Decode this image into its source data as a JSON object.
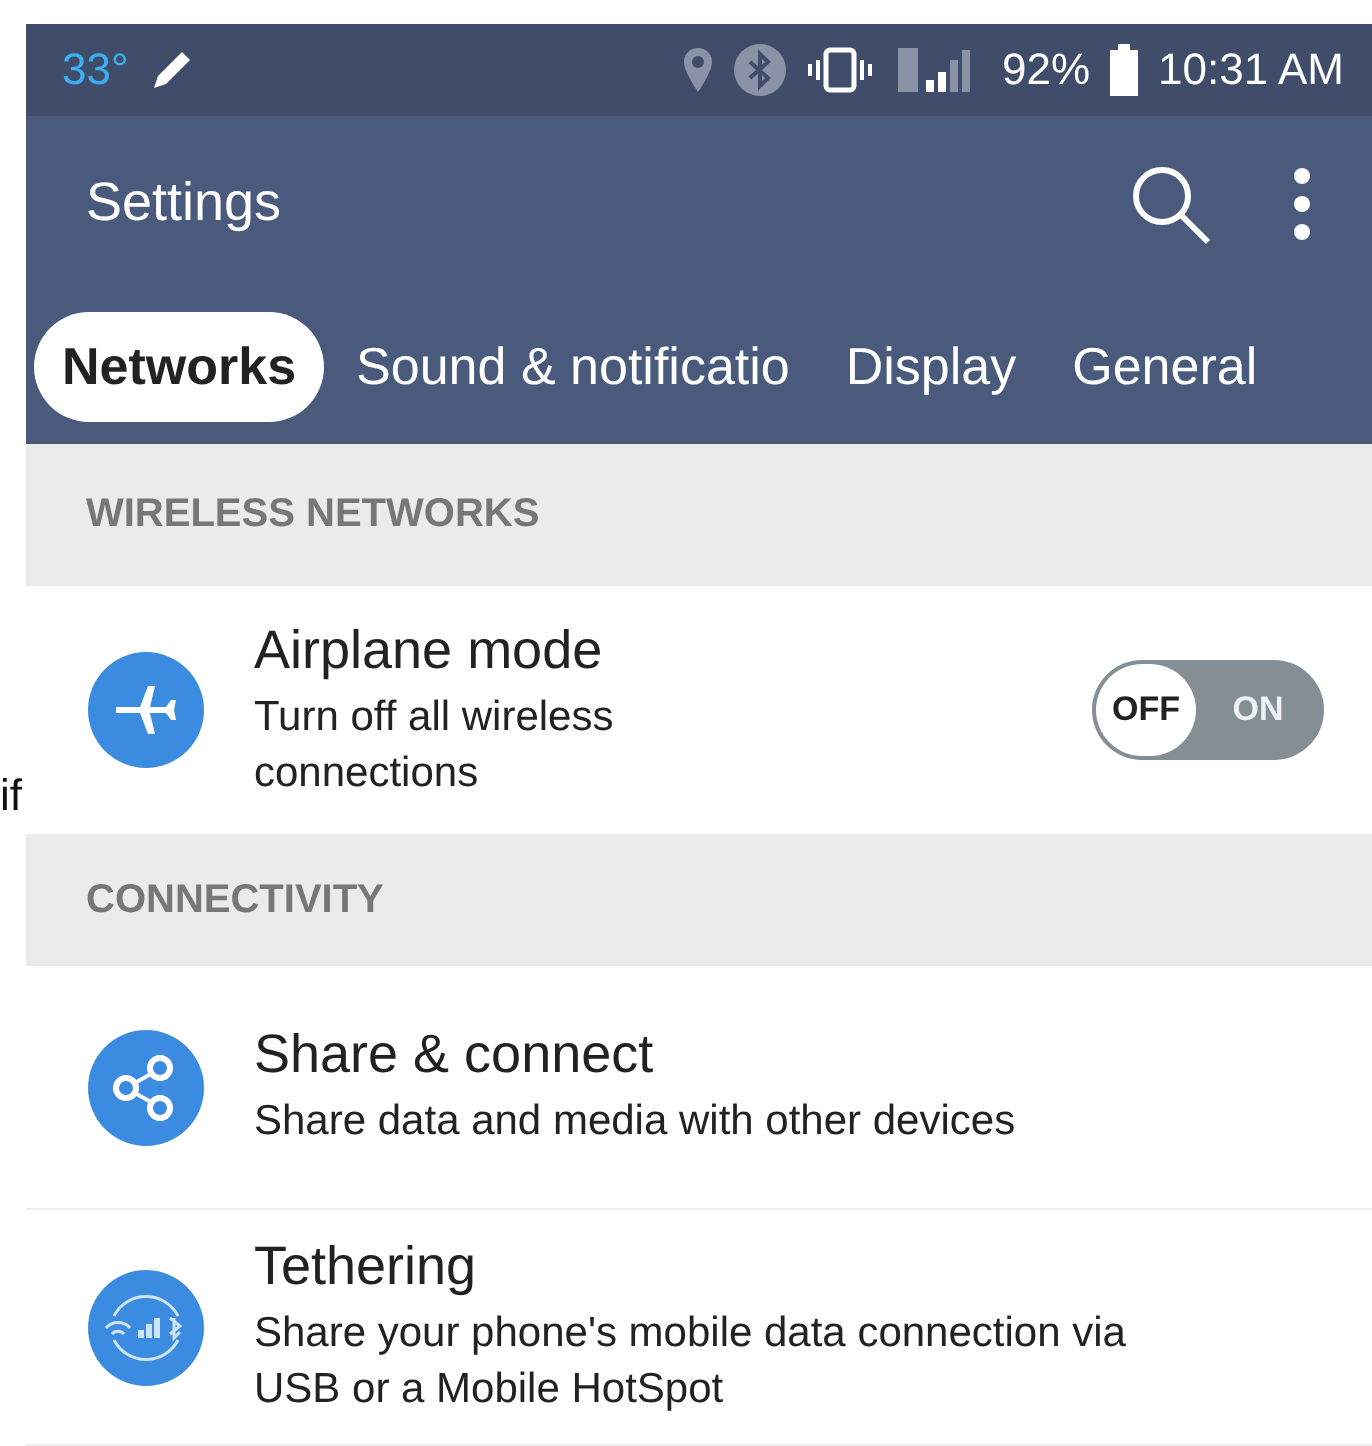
{
  "left_edge_fragment": "if",
  "status_bar": {
    "temperature": "33°",
    "battery": "92%",
    "time": "10:31 AM"
  },
  "app_bar": {
    "title": "Settings"
  },
  "tabs": [
    {
      "label": "Networks",
      "selected": true
    },
    {
      "label": "Sound & notificatio",
      "selected": false
    },
    {
      "label": "Display",
      "selected": false
    },
    {
      "label": "General",
      "selected": false
    }
  ],
  "sections": [
    {
      "header": "WIRELESS NETWORKS",
      "items": [
        {
          "kind": "toggle",
          "title": "Airplane mode",
          "subtitle": "Turn off all wireless connections",
          "on": false,
          "off_label": "OFF",
          "on_label": "ON"
        }
      ]
    },
    {
      "header": "CONNECTIVITY",
      "items": [
        {
          "kind": "plain",
          "title": "Share & connect",
          "subtitle": "Share data and media with other devices"
        },
        {
          "kind": "plain",
          "title": "Tethering",
          "subtitle": "Share your phone's mobile data connection via USB or a Mobile HotSpot"
        }
      ]
    }
  ]
}
